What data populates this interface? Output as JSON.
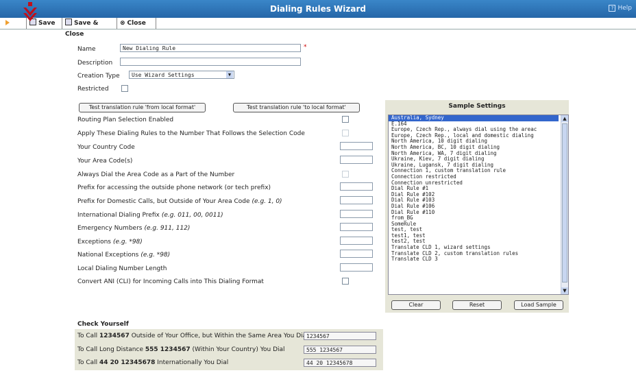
{
  "window": {
    "title": "Dialing Rules Wizard",
    "help": "Help"
  },
  "toolbar": {
    "save": "Save",
    "save_close": "Save & Close",
    "close": "Close"
  },
  "form": {
    "name_label": "Name",
    "name_value": "New Dialing Rule",
    "required": "*",
    "description_label": "Description",
    "description_value": "",
    "creation_type_label": "Creation Type",
    "creation_type_value": "Use Wizard Settings",
    "restricted_label": "Restricted"
  },
  "buttons": {
    "test_from": "Test translation rule 'from local format'",
    "test_to": "Test translation rule 'to local format'"
  },
  "settings": [
    {
      "label": "Routing Plan Selection Enabled",
      "kind": "checkbox"
    },
    {
      "label": "Apply These Dialing Rules to the Number That Follows the Selection Code",
      "kind": "checkbox-disabled"
    },
    {
      "label": "Your Country Code",
      "kind": "text"
    },
    {
      "label": "Your Area Code(s)",
      "kind": "text"
    },
    {
      "label": "Always Dial the Area Code as a Part of the Number",
      "kind": "checkbox-disabled"
    },
    {
      "label": "Prefix for accessing the outside phone network (or tech prefix)",
      "kind": "text"
    },
    {
      "label": "Prefix for Domestic Calls, but Outside of Your Area Code",
      "hint": "(e.g. 1, 0)",
      "kind": "text"
    },
    {
      "label": "International Dialing Prefix",
      "hint": "(e.g. 011, 00, 0011)",
      "kind": "text"
    },
    {
      "label": "Emergency Numbers",
      "hint": "(e.g. 911, 112)",
      "kind": "text"
    },
    {
      "label": "Exceptions",
      "hint": "(e.g. *98)",
      "kind": "text"
    },
    {
      "label": "National Exceptions",
      "hint": "(e.g. *98)",
      "kind": "text"
    },
    {
      "label": "Local Dialing Number Length",
      "kind": "text"
    },
    {
      "label": "Convert ANI (CLI) for Incoming Calls into This Dialing Format",
      "kind": "checkbox"
    }
  ],
  "sample": {
    "title": "Sample Settings",
    "items": [
      "Australia, Sydney",
      "E.164",
      "Europe, Czech Rep., always dial using the areac",
      "Europe, Czech Rep., local and domestic dialing",
      "North America, 10 digit dialing",
      "North America, BC, 10 digit dialing",
      "North America, WA, 7 digit dialing",
      "Ukraine, Kiev, 7 digit dialing",
      "Ukraine, Lugansk, 7 digit dialing",
      "Connection 1, custom translation rule",
      "Connection restricted",
      "Connection unrestricted",
      "Dial Rule #1",
      "Dial Rule #102",
      "Dial Rule #103",
      "Dial Rule #106",
      "Dial Rule #110",
      "from_BG",
      "SomeRule",
      "test, test",
      "test1, test",
      "test2, test",
      "Translate CLD 1, wizard settings",
      "Translate CLD 2, custom translation rules",
      "Translate CLD 3"
    ],
    "selected": "Australia, Sydney",
    "clear": "Clear",
    "reset": "Reset",
    "load": "Load Sample"
  },
  "check": {
    "title": "Check Yourself",
    "rows": [
      {
        "pre": "To Call ",
        "bold": "1234567",
        "post": " Outside of Your Office, but Within the Same Area You Dial",
        "value": "1234567"
      },
      {
        "pre": "To Call Long Distance ",
        "bold": "555 1234567",
        "post": " (Within Your Country) You Dial",
        "value": "555 1234567"
      },
      {
        "pre": "To Call ",
        "bold": "44 20 12345678",
        "post": " Internationally You Dial",
        "value": "44 20 12345678"
      }
    ]
  }
}
